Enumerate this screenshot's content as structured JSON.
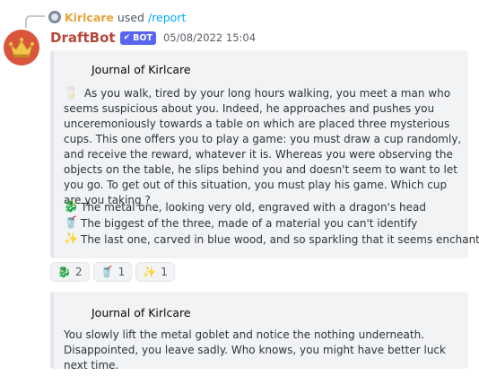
{
  "reply": {
    "user": "Kirlcare",
    "text": "used",
    "command": "/report"
  },
  "message": {
    "author": "DraftBot",
    "bot_tag": "BOT",
    "timestamp": "05/08/2022 15:04",
    "author_color": "#b5483a"
  },
  "embed1": {
    "title": "Journal of Kirlcare",
    "description": "As you walk, tired by your long hours walking, you meet a man who seems suspicious about you. Indeed, he approaches and pushes you unceremoniously towards a table on which are placed three mysterious cups. This one offers you to play a game: you must draw a cup randomly, and receive the reward, whatever it is. Whereas you were observing the objects on the table, he slips behind you and doesn't seem to want to let you go. To get out of this situation, you must play his game. Which cup are you taking ?",
    "choices": [
      {
        "icon": "dragon-icon",
        "text": "The metal one, looking very old, engraved with a dragon's head"
      },
      {
        "icon": "cup-icon",
        "text": "The biggest of the three, made of a material you can't identify"
      },
      {
        "icon": "sparkles-icon",
        "text": "The last one, carved in blue wood, and so sparkling that it seems enchanted"
      }
    ]
  },
  "reactions": [
    {
      "icon": "dragon-icon",
      "count": "2"
    },
    {
      "icon": "cup-icon",
      "count": "1"
    },
    {
      "icon": "sparkles-icon",
      "count": "1"
    }
  ],
  "embed2": {
    "title": "Journal of Kirlcare",
    "description": "You slowly lift the metal goblet and notice the nothing underneath. Disappointed, you leave sadly. Who knows, you might have better luck next time."
  }
}
